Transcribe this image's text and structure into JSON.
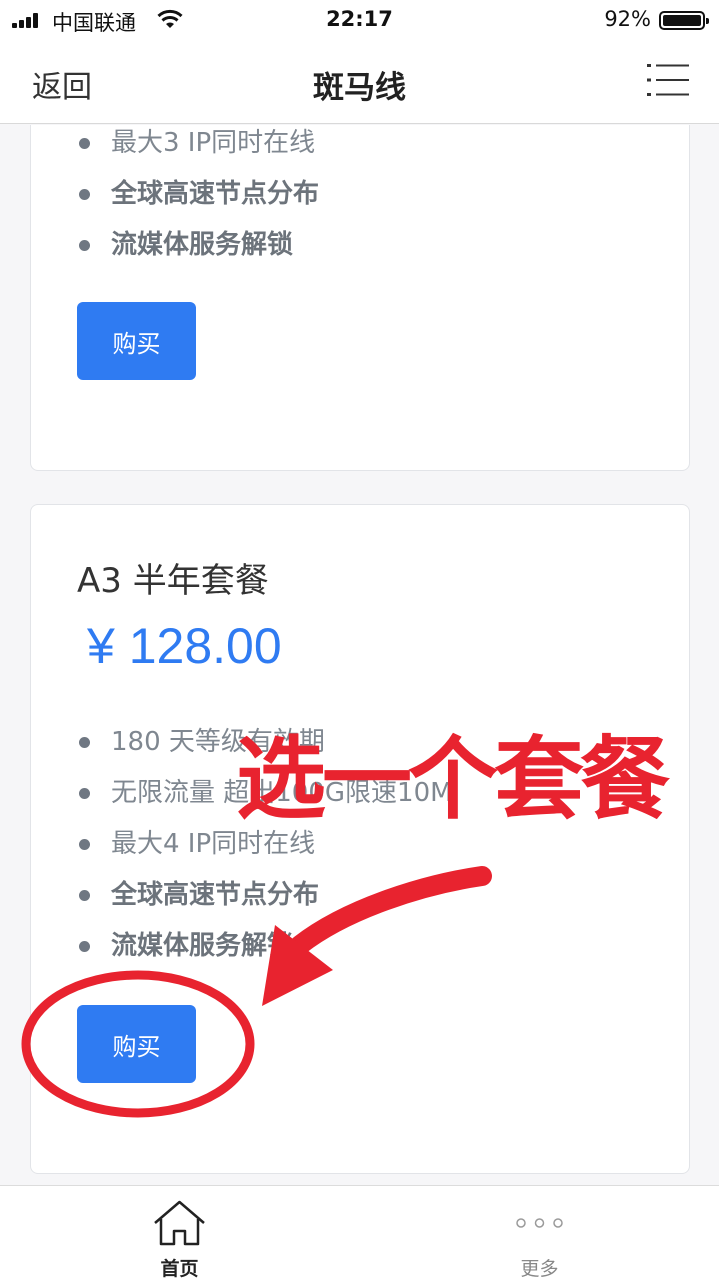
{
  "status_bar": {
    "carrier": "中国联通",
    "time": "22:17",
    "battery_percent": "92%",
    "battery_level": 0.92,
    "icons": [
      "signal-icon",
      "wifi-icon",
      "battery-icon"
    ]
  },
  "nav": {
    "back_label": "返回",
    "title": "斑马线",
    "menu_icon": "menu-list-icon"
  },
  "plans": [
    {
      "features": [
        {
          "text": "最大3 IP同时在线",
          "bold": false
        },
        {
          "text": "全球高速节点分布",
          "bold": true
        },
        {
          "text": "流媒体服务解锁",
          "bold": true
        }
      ],
      "buy_label": "购买"
    },
    {
      "title": "A3 半年套餐",
      "price": "¥ 128.00",
      "features": [
        {
          "text": "180 天等级有效期",
          "bold": false
        },
        {
          "text": "无限流量 超出100G限速10M",
          "bold": false
        },
        {
          "text": "最大4 IP同时在线",
          "bold": false
        },
        {
          "text": "全球高速节点分布",
          "bold": true
        },
        {
          "text": "流媒体服务解锁",
          "bold": true
        }
      ],
      "buy_label": "购买"
    }
  ],
  "annotation": {
    "text": "选一个套餐",
    "color": "#e8232f"
  },
  "tab_bar": {
    "tabs": [
      {
        "label": "首页",
        "icon": "home-icon",
        "active": true
      },
      {
        "label": "更多",
        "icon": "more-dots-icon",
        "active": false
      }
    ]
  },
  "colors": {
    "accent": "#2f7bf2",
    "text": "#333333",
    "muted": "#7f8790"
  }
}
